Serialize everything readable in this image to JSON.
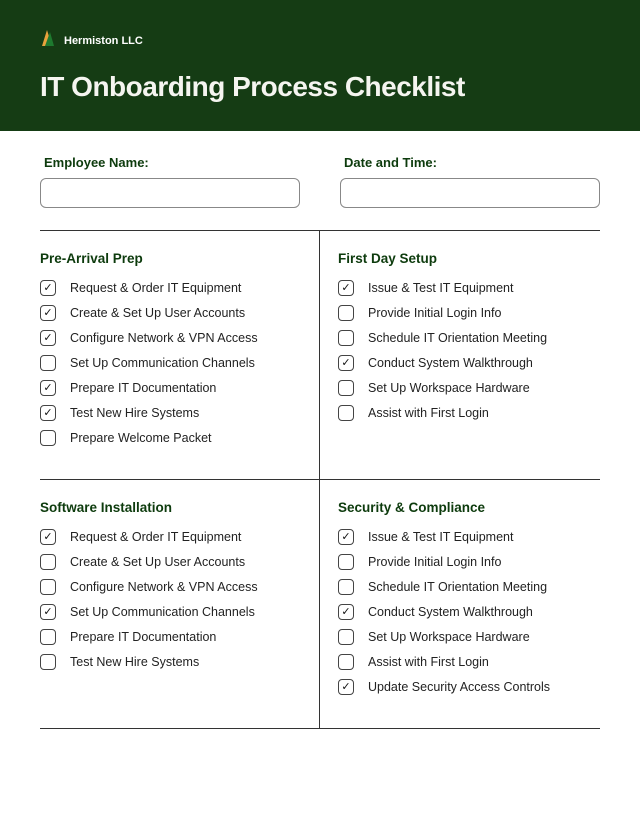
{
  "brand": {
    "name": "Hermiston LLC"
  },
  "title": "IT Onboarding Process Checklist",
  "fields": {
    "employee_name": {
      "label": "Employee Name:",
      "value": ""
    },
    "date_time": {
      "label": "Date and Time:",
      "value": ""
    }
  },
  "sections": [
    {
      "title": "Pre-Arrival Prep",
      "items": [
        {
          "label": "Request & Order IT Equipment",
          "checked": true
        },
        {
          "label": "Create & Set Up User Accounts",
          "checked": true
        },
        {
          "label": "Configure Network & VPN Access",
          "checked": true
        },
        {
          "label": "Set Up Communication Channels",
          "checked": false
        },
        {
          "label": "Prepare IT Documentation",
          "checked": true
        },
        {
          "label": "Test New Hire Systems",
          "checked": true
        },
        {
          "label": "Prepare Welcome Packet",
          "checked": false
        }
      ]
    },
    {
      "title": "First Day Setup",
      "items": [
        {
          "label": "Issue & Test IT Equipment",
          "checked": true
        },
        {
          "label": "Provide Initial Login Info",
          "checked": false
        },
        {
          "label": "Schedule IT Orientation Meeting",
          "checked": false
        },
        {
          "label": "Conduct System Walkthrough",
          "checked": true
        },
        {
          "label": "Set Up Workspace Hardware",
          "checked": false
        },
        {
          "label": "Assist with First Login",
          "checked": false
        }
      ]
    },
    {
      "title": "Software Installation",
      "items": [
        {
          "label": "Request & Order IT Equipment",
          "checked": true
        },
        {
          "label": "Create & Set Up User Accounts",
          "checked": false
        },
        {
          "label": "Configure Network & VPN Access",
          "checked": false
        },
        {
          "label": "Set Up Communication Channels",
          "checked": true
        },
        {
          "label": "Prepare IT Documentation",
          "checked": false
        },
        {
          "label": "Test New Hire Systems",
          "checked": false
        }
      ]
    },
    {
      "title": "Security & Compliance",
      "items": [
        {
          "label": "Issue & Test IT Equipment",
          "checked": true
        },
        {
          "label": "Provide Initial Login Info",
          "checked": false
        },
        {
          "label": "Schedule IT Orientation Meeting",
          "checked": false
        },
        {
          "label": "Conduct System Walkthrough",
          "checked": true
        },
        {
          "label": "Set Up Workspace Hardware",
          "checked": false
        },
        {
          "label": "Assist with First Login",
          "checked": false
        },
        {
          "label": "Update Security Access Controls",
          "checked": true
        }
      ]
    }
  ]
}
